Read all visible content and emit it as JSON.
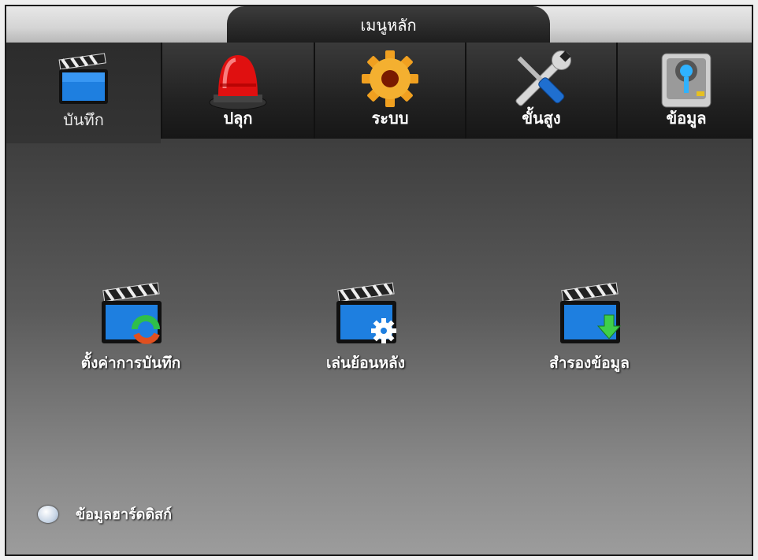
{
  "header": {
    "title": "เมนูหลัก"
  },
  "tabs": [
    {
      "label": "บันทึก",
      "icon": "clapperboard-icon",
      "active": true
    },
    {
      "label": "ปลุก",
      "icon": "siren-icon",
      "active": false
    },
    {
      "label": "ระบบ",
      "icon": "gear-icon",
      "active": false
    },
    {
      "label": "ขั้นสูง",
      "icon": "tools-icon",
      "active": false
    },
    {
      "label": "ข้อมูล",
      "icon": "hard-drive-icon",
      "active": false
    }
  ],
  "items": [
    {
      "label": "ตั้งค่าการบันทึก",
      "icon": "record-settings-icon"
    },
    {
      "label": "เล่นย้อนหลัง",
      "icon": "playback-icon"
    },
    {
      "label": "สำรองข้อมูล",
      "icon": "backup-icon"
    }
  ],
  "footer": {
    "hdd_label": "ข้อมูลฮาร์ดดิสก์"
  },
  "colors": {
    "accent_blue": "#1e7fe0",
    "text": "#ffffff",
    "siren_red": "#e01010",
    "gear_orange": "#f0a020"
  }
}
